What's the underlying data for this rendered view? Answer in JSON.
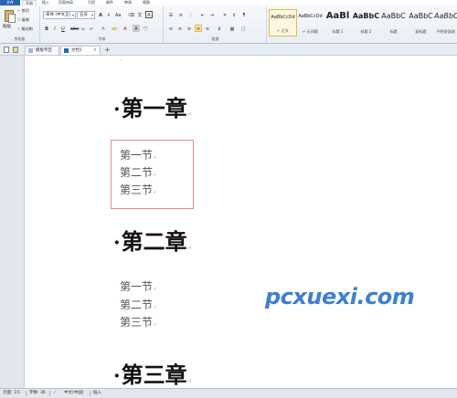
{
  "ribbon_tabs": [
    "文件",
    "开始",
    "插入",
    "页面布局",
    "引用",
    "邮件",
    "审阅",
    "视图"
  ],
  "clipboard": {
    "paste": "粘贴",
    "cut": "剪切",
    "copy": "复制",
    "format_painter": "格式刷",
    "group_label": "剪贴板"
  },
  "font": {
    "font_name": "宋体 (中文正)",
    "font_size": "五号",
    "group_label": "字体"
  },
  "paragraph": {
    "group_label": "段落"
  },
  "styles": [
    {
      "sample": "AaBbCcDd",
      "name": "↵ 正文"
    },
    {
      "sample": "AaBbCcDd",
      "name": "↵ 无间隔"
    },
    {
      "sample": "AaBl",
      "name": "标题 1"
    },
    {
      "sample": "AaBbC",
      "name": "标题 2"
    },
    {
      "sample": "AaBbC",
      "name": "标题"
    },
    {
      "sample": "AaBbC",
      "name": "副标题"
    },
    {
      "sample": "AaBbC",
      "name": "不明显强调"
    }
  ],
  "tabs_bar": {
    "tab1": "模板专区",
    "tab2": "文档1"
  },
  "document": {
    "chapter1": "第一章",
    "sections1": [
      "第一节",
      "第二节",
      "第三节"
    ],
    "chapter2": "第二章",
    "sections2": [
      "第一节",
      "第二节",
      "第三节"
    ],
    "chapter3": "第三章",
    "bullet": "·",
    "para_mark": "↵"
  },
  "watermark": "pcxuexi.com",
  "status": {
    "page": "页面: 1/1",
    "words": "字数: 36",
    "language": "中文(中国)",
    "mode": "插入"
  }
}
